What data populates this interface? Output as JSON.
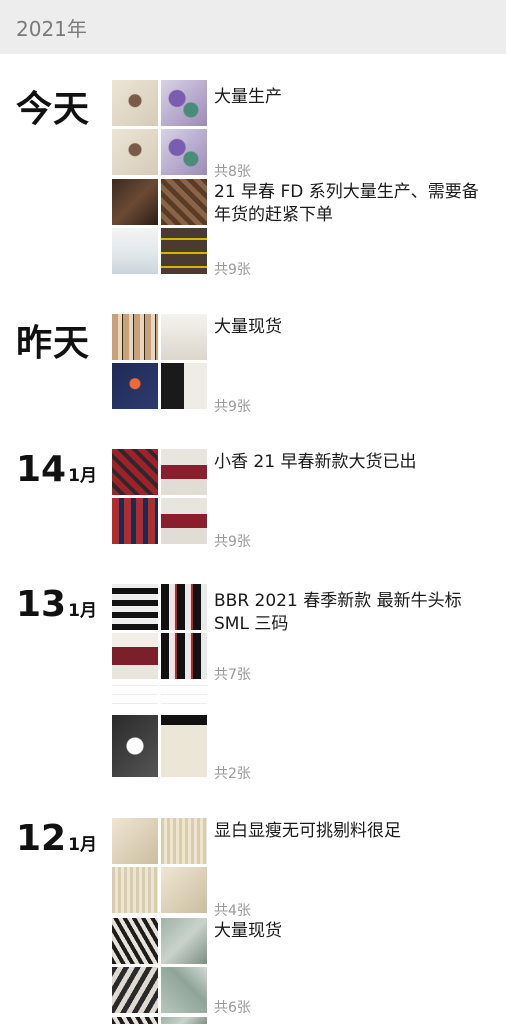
{
  "header": {
    "year": "2021年"
  },
  "groups": [
    {
      "date_word": "今天",
      "posts": [
        {
          "text": "大量生产",
          "count": "共8张"
        },
        {
          "text": "21 早春 FD 系列大量生产、需要备年货的赶紧下单",
          "count": "共9张"
        }
      ]
    },
    {
      "date_word": "昨天",
      "posts": [
        {
          "text": "大量现货",
          "count": "共9张"
        }
      ]
    },
    {
      "day": "14",
      "month": "1月",
      "posts": [
        {
          "text": "小香 21 早春新款大货已出",
          "count": "共9张"
        }
      ]
    },
    {
      "day": "13",
      "month": "1月",
      "posts": [
        {
          "text": "BBR 2021 春季新款  最新牛头标 SML 三码",
          "count": "共7张"
        },
        {
          "text": "",
          "count": "共2张"
        }
      ]
    },
    {
      "day": "12",
      "month": "1月",
      "posts": [
        {
          "text": "显白显瘦无可挑剔料很足",
          "count": "共4张"
        },
        {
          "text": "大量现货",
          "count": "共6张"
        }
      ]
    }
  ]
}
